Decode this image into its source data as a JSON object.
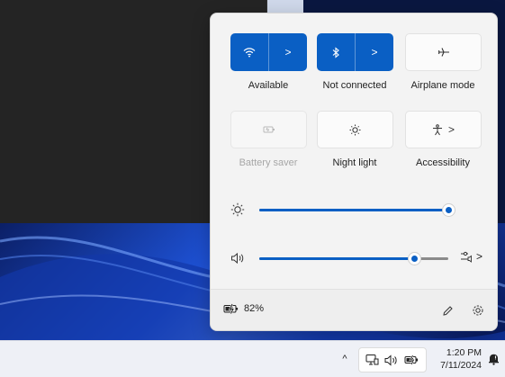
{
  "quick_settings": {
    "tiles": [
      {
        "label": "Available",
        "icon": "wifi-icon",
        "state": "on",
        "has_chevron": true,
        "chevron": ">"
      },
      {
        "label": "Not connected",
        "icon": "bluetooth-icon",
        "state": "on",
        "has_chevron": true,
        "chevron": ">"
      },
      {
        "label": "Airplane mode",
        "icon": "airplane-icon",
        "state": "off"
      },
      {
        "label": "Battery saver",
        "icon": "battery-saver-icon",
        "state": "disabled"
      },
      {
        "label": "Night light",
        "icon": "night-light-icon",
        "state": "off"
      },
      {
        "label": "Accessibility",
        "icon": "accessibility-icon",
        "state": "off",
        "chevron": ">"
      }
    ],
    "brightness": {
      "icon": "brightness-icon",
      "level": 1.0
    },
    "volume": {
      "icon": "volume-icon",
      "level": 0.82,
      "output_icon": "audio-output-icon",
      "output_chevron": ">"
    },
    "footer": {
      "battery_percent": "82%",
      "battery_icon": "battery-charging-icon",
      "edit_icon": "pencil-icon",
      "settings_icon": "gear-icon"
    }
  },
  "taskbar": {
    "chevron": "^",
    "tray_icons": [
      "network-icon",
      "speaker-icon",
      "battery-icon"
    ],
    "time": "1:20 PM",
    "date": "7/11/2024",
    "notification_icon": "notification-bell-icon"
  },
  "colors": {
    "accent": "#0a5fc4",
    "panel": "#f3f3f3",
    "taskbar": "#eef0f6"
  }
}
